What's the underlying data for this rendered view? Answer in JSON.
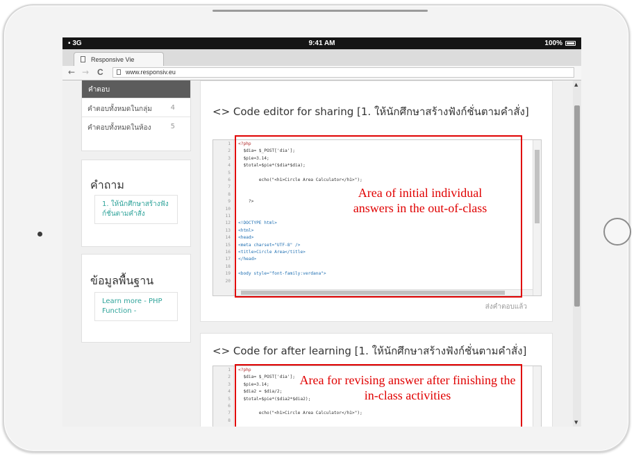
{
  "status_bar": {
    "signal": "3G",
    "time": "9:41 AM",
    "battery": "100%"
  },
  "browser": {
    "tab_title": "Responsive Vie",
    "back_glyph": "←",
    "forward_glyph": "→",
    "reload_glyph": "C",
    "url": "www.responsiv.eu"
  },
  "sidebar": {
    "menu": {
      "header": "คำตอบ",
      "items": [
        {
          "label": "คำตอบทั้งหมดในกลุ่ม",
          "count": "4"
        },
        {
          "label": "คำตอบทั้งหมดในห้อง",
          "count": "5"
        }
      ]
    },
    "questions": {
      "title": "คำถาม",
      "link": "1. ให้นักศึกษาสร้างฟังก์ชั่นตามคำสั่ง"
    },
    "basics": {
      "title": "ข้อมูลพื้นฐาน",
      "link": "Learn more - PHP Function -"
    }
  },
  "editor1": {
    "title": "<> Code editor for sharing [1. ให้นักศึกษาสร้างฟังก์ชั่นตามคำสั่ง]",
    "line_numbers": [
      "1",
      "2",
      "3",
      "4",
      "5",
      "6",
      "7",
      "8",
      "9",
      "10",
      "11",
      "12",
      "13",
      "14",
      "15",
      "16",
      "17",
      "18",
      "19",
      "20"
    ],
    "lines": [
      "<?php",
      "  $dia= $_POST['dia'];",
      "  $pie=3.14;",
      "  $total=$pie*($dia*$dia);",
      "",
      "        echo(\"<h1>Circle Area Calculator</h1>\");",
      "",
      "",
      "    ?>",
      "",
      "",
      "<!DOCTYPE html>",
      "<html>",
      "<head>",
      "<meta charset=\"UTF-8\" />",
      "<title>Circle Area</title>",
      "</head>",
      "",
      "<body style=\"font-family:verdana\">",
      ""
    ],
    "annotation": "Area of initial individual answers in the out-of-class",
    "submit_label": "ส่งคำตอบแล้ว"
  },
  "editor2": {
    "title": "<> Code for after learning [1. ให้นักศึกษาสร้างฟังก์ชั่นตามคำสั่ง]",
    "line_numbers": [
      "1",
      "2",
      "3",
      "4",
      "5",
      "6",
      "7",
      "8"
    ],
    "lines": [
      "<?php",
      "  $dia= $_POST['dia'];",
      "  $pie=3.14;",
      "  $dia2 = $dia/2;",
      "  $total=$pie*($dia2*$dia2);",
      "",
      "        echo(\"<h1>Circle Area Calculator</h1>\");",
      ""
    ],
    "annotation": "Area for revising answer after finishing the in-class activities"
  },
  "colors": {
    "annotation_red": "#e00000",
    "link_teal": "#2fa39a",
    "menu_header_bg": "#5c5c5c"
  }
}
